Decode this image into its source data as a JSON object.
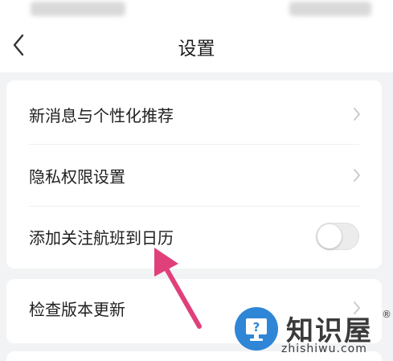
{
  "nav": {
    "title": "设置"
  },
  "settings_group_1": {
    "items": [
      {
        "label": "新消息与个性化推荐",
        "control": "chevron-right-icon"
      },
      {
        "label": "隐私权限设置",
        "control": "chevron-right-icon"
      },
      {
        "label": "添加关注航班到日历",
        "control": "toggle",
        "toggle_on": false
      }
    ]
  },
  "settings_group_2": {
    "items": [
      {
        "label": "检查版本更新",
        "control": "chevron-right-icon"
      }
    ]
  },
  "watermark": {
    "name": "知识屋",
    "registered_mark": "®",
    "url": "zhishiwu.com",
    "icon": "monitor-question-icon"
  },
  "colors": {
    "page_background": "#f2f3f5",
    "card_background": "#ffffff",
    "arrow": "#e0407a",
    "watermark_blue": "#2f86d6",
    "toggle_off": "#ececec"
  }
}
